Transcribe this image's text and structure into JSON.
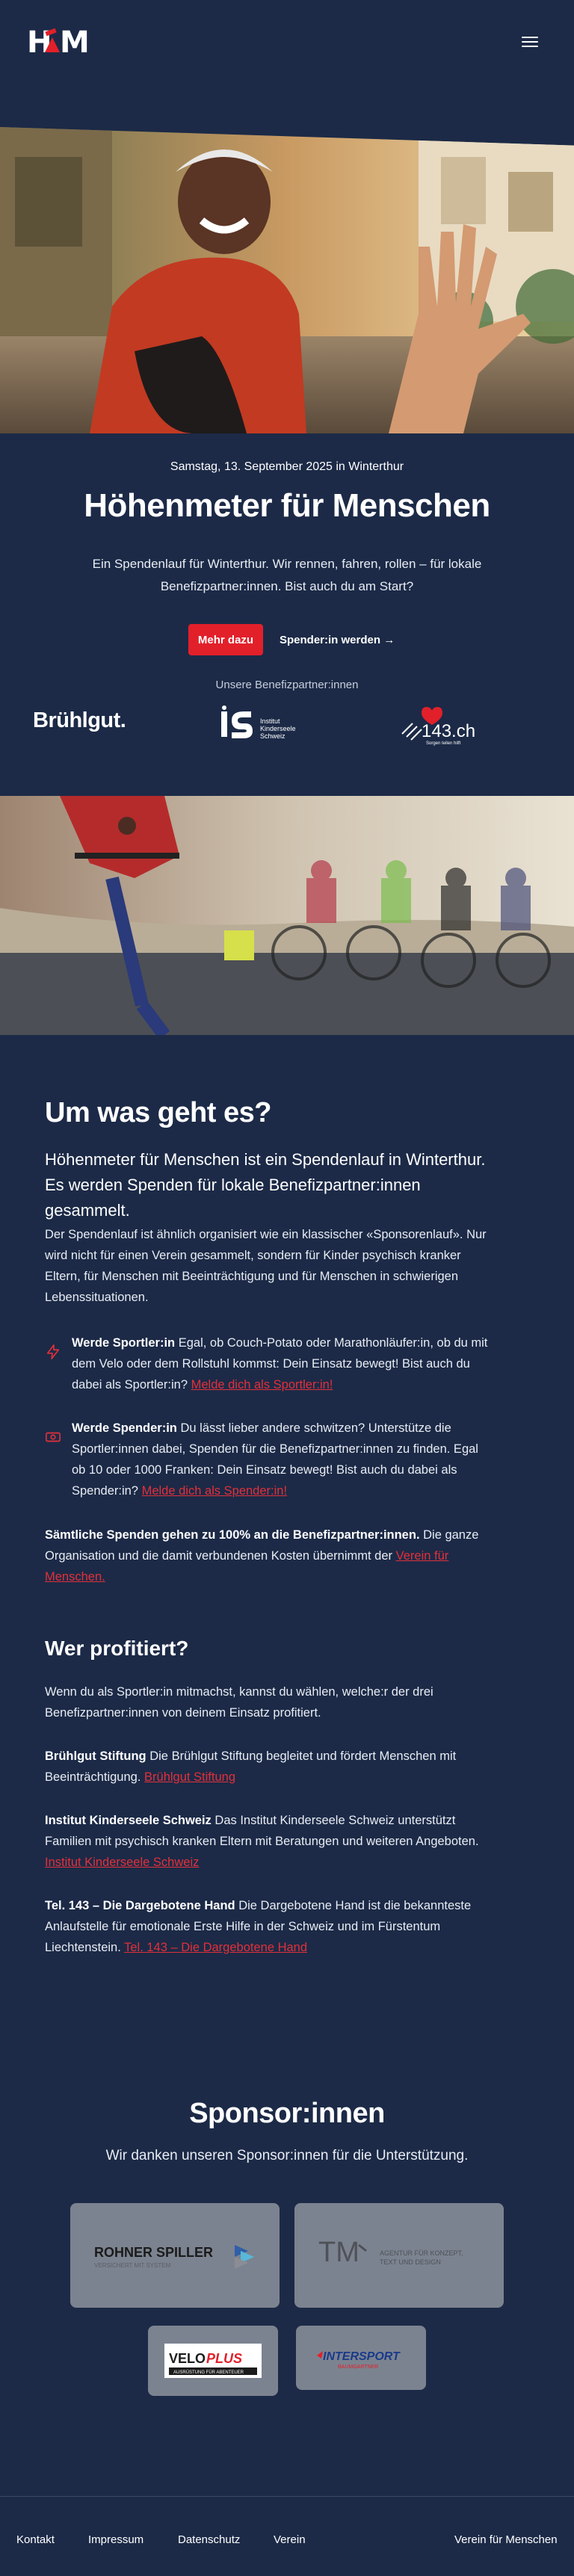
{
  "header": {
    "logo_text": "H",
    "logo_text2": "M",
    "menu_icon": "hamburger-menu-icon"
  },
  "hero": {
    "date": "Samstag, 13. September 2025 in Winterthur",
    "title": "Höhenmeter für Menschen",
    "intro": "Ein Spendenlauf für Winterthur. Wir rennen, fahren, rollen – für lokale Benefizpartner:innen. Bist auch du am Start?",
    "primary_button": "Mehr dazu",
    "secondary_button": "Spender:in werden →",
    "partners_label": "Unsere Benefizpartner:innen"
  },
  "partner_logos": {
    "bruhlgut": "Brühlgut.",
    "iks_line1": "Institut",
    "iks_line2": "Kinderseele",
    "iks_line3": "Schweiz",
    "tel143": "143.ch",
    "tel143_sub": "Sorgen teilen hilft"
  },
  "about": {
    "title": "Um was geht es?",
    "lead": "Höhenmeter für Menschen ist ein Spendenlauf in Winterthur. Es werden Spenden für lokale Benefizpartner:innen gesammelt.",
    "paragraph": "Der Spendenlauf ist ähnlich organisiert wie ein klassischer «Sponsorenlauf». Nur wird nicht für einen Verein gesammelt, sondern für Kinder psychisch kranker Eltern, für Menschen mit Beeinträchtigung und für Menschen in schwierigen Lebenssituationen.",
    "athlete_bold": "Werde Sportler:in",
    "athlete_text": " Egal, ob Couch-Potato oder Marathonläufer:in, ob du mit dem Velo oder dem Rollstuhl kommst: Dein Einsatz bewegt! Bist auch du dabei als Sportler:in? ",
    "athlete_link": "Melde dich als Sportler:in!",
    "donor_bold": "Werde Spender:in",
    "donor_text": " Du lässt lieber andere schwitzen? Unterstütze die Sportler:innen dabei, Spenden für die Benefizpartner:innen zu finden. Egal ob 10 oder 1000 Franken: Dein Einsatz bewegt! Bist auch du dabei als Spender:in? ",
    "donor_link": "Melde dich als Spender:in!",
    "full_bold": "Sämtliche Spenden gehen zu 100% an die Benefizpartner:innen.",
    "full_text": " Die ganze Organisation und die damit verbundenen Kosten übernimmt der ",
    "full_link": "Verein für Menschen."
  },
  "beneficiaries": {
    "title": "Wer profitiert?",
    "intro": "Wenn du als Sportler:in mitmachst, kannst du wählen, welche:r der drei Benefizpartner:innen von deinem Einsatz profitiert.",
    "p1_bold": "Brühlgut Stiftung",
    "p1_text": " Die Brühlgut Stiftung begleitet und fördert Menschen mit Beeinträchtigung. ",
    "p1_link": "Brühlgut Stiftung",
    "p2_bold": "Institut Kinderseele Schweiz",
    "p2_text": " Das Institut Kinderseele Schweiz unterstützt Familien mit psychisch kranken Eltern mit Beratungen und weiteren Angeboten. ",
    "p2_link": "Institut Kinderseele Schweiz",
    "p3_bold": "Tel. 143 – Die Dargebotene Hand",
    "p3_text": " Die Dargebotene Hand ist die bekannteste Anlaufstelle für emotionale Erste Hilfe in der Schweiz und im Fürstentum Liechtenstein. ",
    "p3_link": "Tel. 143 – Die Dargebotene Hand"
  },
  "sponsors": {
    "title": "Sponsor:innen",
    "subtitle": "Wir danken unseren Sponsor:innen für die Unterstützung.",
    "rohner": "ROHNER SPILLER",
    "rohner_sub": "VERSICHERT MIT SYSTEM",
    "tm": "TM",
    "tm_sub1": "AGENTUR FÜR KONZEPT,",
    "tm_sub2": "TEXT UND DESIGN",
    "veloplus_a": "VELO",
    "veloplus_b": "PLUS",
    "veloplus_sub": "AUSRÜSTUNG FÜR ABENTEUER",
    "intersport": "INTERSPORT",
    "intersport_sub": "BAUMGARTNER"
  },
  "footer": {
    "links": [
      "Kontakt",
      "Impressum",
      "Datenschutz",
      "Verein"
    ],
    "right": "Verein für Menschen"
  },
  "colors": {
    "background": "#1c2a47",
    "accent": "#e2202a",
    "card": "#7c8390"
  }
}
